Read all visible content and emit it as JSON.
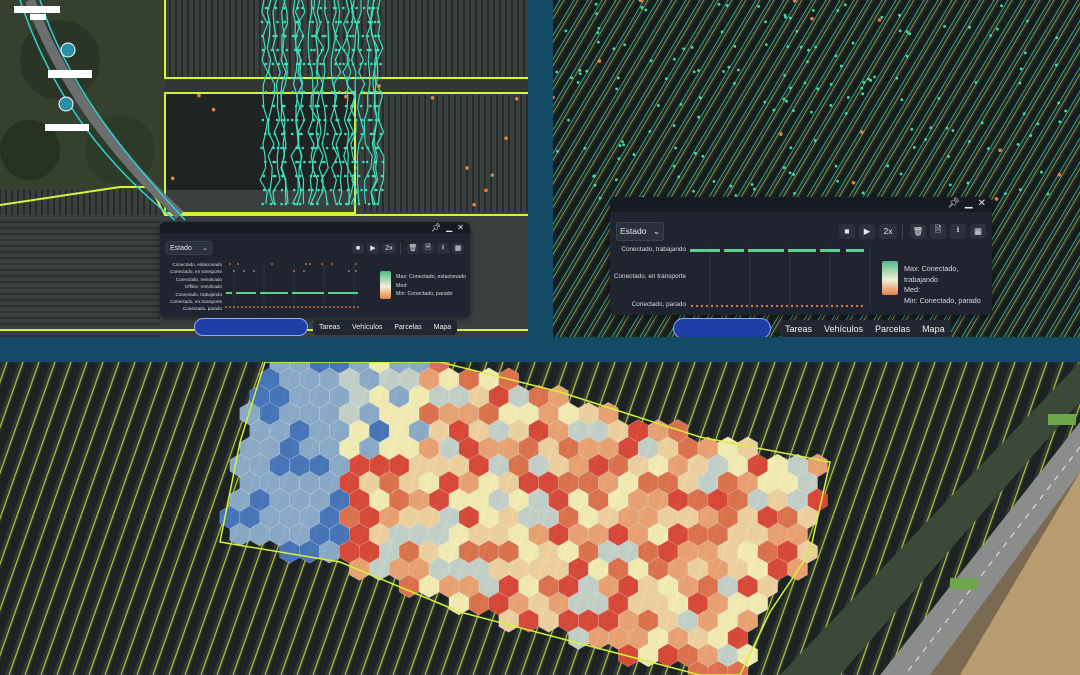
{
  "panels": {
    "left": {
      "select_label": "Estado",
      "speed_label": "2x",
      "states": [
        "Conectado, estacionado",
        "Conectado, en transporte",
        "Conectado, remolcado",
        "Offline, remolcado",
        "Conectado, trabajando",
        "Conectado, en transporte",
        "Conectado, parado"
      ],
      "legend": {
        "max": "Max: Conectado, estacionado",
        "med": "Med:",
        "min": "Min: Conectado, parado"
      },
      "tabs": [
        "Tareas",
        "Vehículos",
        "Parcelas",
        "Mapa"
      ]
    },
    "right": {
      "select_label": "Estado",
      "speed_label": "2x",
      "states": [
        "Conectado, trabajando",
        "Conectado, en transporte",
        "Conectado, parado"
      ],
      "legend": {
        "max": "Max: Conectado, trabajando",
        "med": "Med:",
        "min": "Min: Conectado, parado"
      },
      "tabs": [
        "Tareas",
        "Vehículos",
        "Parcelas",
        "Mapa"
      ]
    }
  },
  "colors": {
    "background": "#134a66",
    "parcel_outline": "#d6f23a",
    "track": "#3fe0c0",
    "heat_low": "#4a78c0",
    "heat_mid": "#fbf3b8",
    "heat_high": "#e04b3a",
    "legend_max": "#4dbb83",
    "legend_min": "#e77e46"
  },
  "icons": [
    "pin-icon",
    "minimize-icon",
    "close-icon",
    "stop-icon",
    "play-icon",
    "trash-icon",
    "document-icon",
    "download-icon",
    "grid-icon",
    "chevron-down-icon"
  ]
}
